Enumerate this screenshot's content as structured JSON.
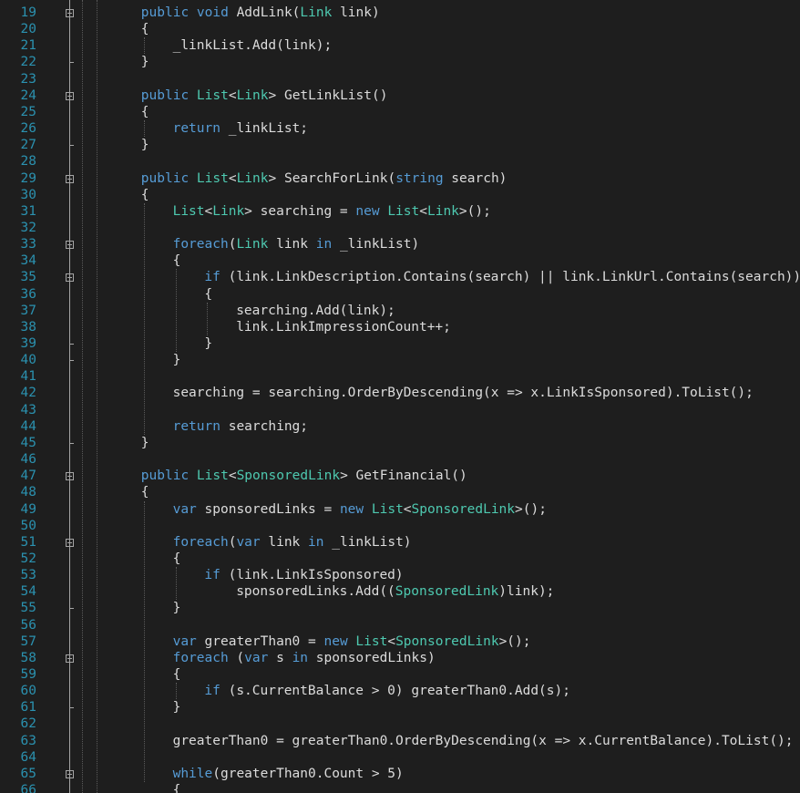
{
  "editor": {
    "theme_colors": {
      "background": "#1e1e1e",
      "line_number": "#2b91af",
      "keyword": "#569cd6",
      "type": "#4ec9b0",
      "text": "#dcdcdc"
    },
    "lines": [
      {
        "n": "19",
        "indent": 4,
        "tokens": [
          [
            "k",
            "public"
          ],
          [
            "t",
            " "
          ],
          [
            "k",
            "void"
          ],
          [
            "t",
            " AddLink("
          ],
          [
            "y",
            "Link"
          ],
          [
            "t",
            " link)"
          ]
        ]
      },
      {
        "n": "20",
        "indent": 4,
        "tokens": [
          [
            "t",
            "{"
          ]
        ]
      },
      {
        "n": "21",
        "indent": 8,
        "tokens": [
          [
            "t",
            "_linkList.Add(link);"
          ]
        ]
      },
      {
        "n": "22",
        "indent": 4,
        "tokens": [
          [
            "t",
            "}"
          ]
        ]
      },
      {
        "n": "23",
        "indent": 0,
        "tokens": []
      },
      {
        "n": "24",
        "indent": 4,
        "tokens": [
          [
            "k",
            "public"
          ],
          [
            "t",
            " "
          ],
          [
            "y",
            "List"
          ],
          [
            "t",
            "<"
          ],
          [
            "y",
            "Link"
          ],
          [
            "t",
            "> GetLinkList()"
          ]
        ]
      },
      {
        "n": "25",
        "indent": 4,
        "tokens": [
          [
            "t",
            "{"
          ]
        ]
      },
      {
        "n": "26",
        "indent": 8,
        "tokens": [
          [
            "k",
            "return"
          ],
          [
            "t",
            " _linkList;"
          ]
        ]
      },
      {
        "n": "27",
        "indent": 4,
        "tokens": [
          [
            "t",
            "}"
          ]
        ]
      },
      {
        "n": "28",
        "indent": 0,
        "tokens": []
      },
      {
        "n": "29",
        "indent": 4,
        "tokens": [
          [
            "k",
            "public"
          ],
          [
            "t",
            " "
          ],
          [
            "y",
            "List"
          ],
          [
            "t",
            "<"
          ],
          [
            "y",
            "Link"
          ],
          [
            "t",
            "> SearchForLink("
          ],
          [
            "k",
            "string"
          ],
          [
            "t",
            " search)"
          ]
        ]
      },
      {
        "n": "30",
        "indent": 4,
        "tokens": [
          [
            "t",
            "{"
          ]
        ]
      },
      {
        "n": "31",
        "indent": 8,
        "tokens": [
          [
            "y",
            "List"
          ],
          [
            "t",
            "<"
          ],
          [
            "y",
            "Link"
          ],
          [
            "t",
            "> searching = "
          ],
          [
            "k",
            "new"
          ],
          [
            "t",
            " "
          ],
          [
            "y",
            "List"
          ],
          [
            "t",
            "<"
          ],
          [
            "y",
            "Link"
          ],
          [
            "t",
            ">();"
          ]
        ]
      },
      {
        "n": "32",
        "indent": 0,
        "tokens": []
      },
      {
        "n": "33",
        "indent": 8,
        "tokens": [
          [
            "k",
            "foreach"
          ],
          [
            "t",
            "("
          ],
          [
            "y",
            "Link"
          ],
          [
            "t",
            " link "
          ],
          [
            "k",
            "in"
          ],
          [
            "t",
            " _linkList)"
          ]
        ]
      },
      {
        "n": "34",
        "indent": 8,
        "tokens": [
          [
            "t",
            "{"
          ]
        ]
      },
      {
        "n": "35",
        "indent": 12,
        "tokens": [
          [
            "k",
            "if"
          ],
          [
            "t",
            " (link.LinkDescription.Contains(search) || link.LinkUrl.Contains(search))"
          ]
        ]
      },
      {
        "n": "36",
        "indent": 12,
        "tokens": [
          [
            "t",
            "{"
          ]
        ]
      },
      {
        "n": "37",
        "indent": 16,
        "tokens": [
          [
            "t",
            "searching.Add(link);"
          ]
        ]
      },
      {
        "n": "38",
        "indent": 16,
        "tokens": [
          [
            "t",
            "link.LinkImpressionCount++;"
          ]
        ]
      },
      {
        "n": "39",
        "indent": 12,
        "tokens": [
          [
            "t",
            "}"
          ]
        ]
      },
      {
        "n": "40",
        "indent": 8,
        "tokens": [
          [
            "t",
            "}"
          ]
        ]
      },
      {
        "n": "41",
        "indent": 0,
        "tokens": []
      },
      {
        "n": "42",
        "indent": 8,
        "tokens": [
          [
            "t",
            "searching = searching.OrderByDescending(x => x.LinkIsSponsored).ToList();"
          ]
        ]
      },
      {
        "n": "43",
        "indent": 0,
        "tokens": []
      },
      {
        "n": "44",
        "indent": 8,
        "tokens": [
          [
            "k",
            "return"
          ],
          [
            "t",
            " searching;"
          ]
        ]
      },
      {
        "n": "45",
        "indent": 4,
        "tokens": [
          [
            "t",
            "}"
          ]
        ]
      },
      {
        "n": "46",
        "indent": 0,
        "tokens": []
      },
      {
        "n": "47",
        "indent": 4,
        "tokens": [
          [
            "k",
            "public"
          ],
          [
            "t",
            " "
          ],
          [
            "y",
            "List"
          ],
          [
            "t",
            "<"
          ],
          [
            "y",
            "SponsoredLink"
          ],
          [
            "t",
            "> GetFinancial()"
          ]
        ]
      },
      {
        "n": "48",
        "indent": 4,
        "tokens": [
          [
            "t",
            "{"
          ]
        ]
      },
      {
        "n": "49",
        "indent": 8,
        "tokens": [
          [
            "k",
            "var"
          ],
          [
            "t",
            " sponsoredLinks = "
          ],
          [
            "k",
            "new"
          ],
          [
            "t",
            " "
          ],
          [
            "y",
            "List"
          ],
          [
            "t",
            "<"
          ],
          [
            "y",
            "SponsoredLink"
          ],
          [
            "t",
            ">();"
          ]
        ]
      },
      {
        "n": "50",
        "indent": 0,
        "tokens": []
      },
      {
        "n": "51",
        "indent": 8,
        "tokens": [
          [
            "k",
            "foreach"
          ],
          [
            "t",
            "("
          ],
          [
            "k",
            "var"
          ],
          [
            "t",
            " link "
          ],
          [
            "k",
            "in"
          ],
          [
            "t",
            " _linkList)"
          ]
        ]
      },
      {
        "n": "52",
        "indent": 8,
        "tokens": [
          [
            "t",
            "{"
          ]
        ]
      },
      {
        "n": "53",
        "indent": 12,
        "tokens": [
          [
            "k",
            "if"
          ],
          [
            "t",
            " (link.LinkIsSponsored)"
          ]
        ]
      },
      {
        "n": "54",
        "indent": 16,
        "tokens": [
          [
            "t",
            "sponsoredLinks.Add(("
          ],
          [
            "y",
            "SponsoredLink"
          ],
          [
            "t",
            ")link);"
          ]
        ]
      },
      {
        "n": "55",
        "indent": 8,
        "tokens": [
          [
            "t",
            "}"
          ]
        ]
      },
      {
        "n": "56",
        "indent": 0,
        "tokens": []
      },
      {
        "n": "57",
        "indent": 8,
        "tokens": [
          [
            "k",
            "var"
          ],
          [
            "t",
            " greaterThan0 = "
          ],
          [
            "k",
            "new"
          ],
          [
            "t",
            " "
          ],
          [
            "y",
            "List"
          ],
          [
            "t",
            "<"
          ],
          [
            "y",
            "SponsoredLink"
          ],
          [
            "t",
            ">();"
          ]
        ]
      },
      {
        "n": "58",
        "indent": 8,
        "tokens": [
          [
            "k",
            "foreach"
          ],
          [
            "t",
            " ("
          ],
          [
            "k",
            "var"
          ],
          [
            "t",
            " s "
          ],
          [
            "k",
            "in"
          ],
          [
            "t",
            " sponsoredLinks)"
          ]
        ]
      },
      {
        "n": "59",
        "indent": 8,
        "tokens": [
          [
            "t",
            "{"
          ]
        ]
      },
      {
        "n": "60",
        "indent": 12,
        "tokens": [
          [
            "k",
            "if"
          ],
          [
            "t",
            " (s.CurrentBalance > 0) greaterThan0.Add(s);"
          ]
        ]
      },
      {
        "n": "61",
        "indent": 8,
        "tokens": [
          [
            "t",
            "}"
          ]
        ]
      },
      {
        "n": "62",
        "indent": 0,
        "tokens": []
      },
      {
        "n": "63",
        "indent": 8,
        "tokens": [
          [
            "t",
            "greaterThan0 = greaterThan0.OrderByDescending(x => x.CurrentBalance).ToList();"
          ]
        ]
      },
      {
        "n": "64",
        "indent": 0,
        "tokens": []
      },
      {
        "n": "65",
        "indent": 8,
        "tokens": [
          [
            "k",
            "while"
          ],
          [
            "t",
            "(greaterThan0.Count > 5)"
          ]
        ]
      },
      {
        "n": "66",
        "indent": 8,
        "tokens": [
          [
            "t",
            "{"
          ]
        ]
      }
    ]
  }
}
